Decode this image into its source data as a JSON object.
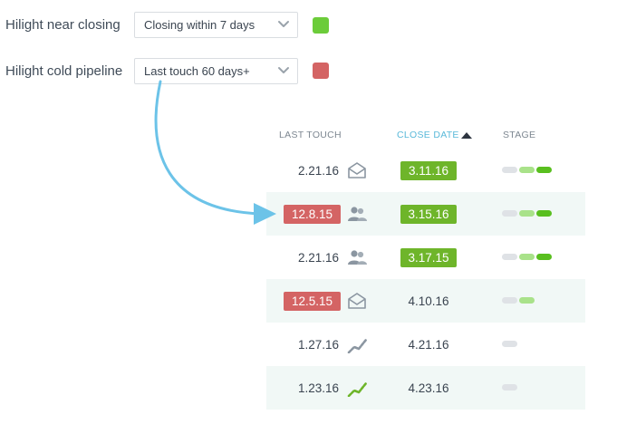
{
  "controls": {
    "near_closing": {
      "label": "Hilight near closing",
      "value": "Closing within 7 days",
      "swatch_color": "#6ccc3a"
    },
    "cold_pipeline": {
      "label": "Hilight cold pipeline",
      "value": "Last touch 60 days+",
      "swatch_color": "#d46464"
    }
  },
  "table": {
    "headers": {
      "last_touch": "LAST TOUCH",
      "close_date": "CLOSE DATE",
      "stage": "STAGE"
    },
    "rows": [
      {
        "last_touch": "2.21.16",
        "last_touch_highlight": false,
        "icon": "email-icon",
        "close_date": "3.11.16",
        "close_date_highlight": true,
        "stage": [
          "#dfe2e6",
          "#a9e28a",
          "#59bf1f"
        ]
      },
      {
        "last_touch": "12.8.15",
        "last_touch_highlight": true,
        "icon": "people-icon",
        "close_date": "3.15.16",
        "close_date_highlight": true,
        "stage": [
          "#dfe2e6",
          "#a9e28a",
          "#59bf1f"
        ]
      },
      {
        "last_touch": "2.21.16",
        "last_touch_highlight": false,
        "icon": "people-icon",
        "close_date": "3.17.15",
        "close_date_highlight": true,
        "stage": [
          "#dfe2e6",
          "#a9e28a",
          "#59bf1f"
        ]
      },
      {
        "last_touch": "12.5.15",
        "last_touch_highlight": true,
        "icon": "email-icon",
        "close_date": "4.10.16",
        "close_date_highlight": false,
        "stage": [
          "#dfe2e6",
          "#a9e28a"
        ]
      },
      {
        "last_touch": "1.27.16",
        "last_touch_highlight": false,
        "icon": "web-activity-icon",
        "close_date": "4.21.16",
        "close_date_highlight": false,
        "stage": [
          "#dfe2e6"
        ]
      },
      {
        "last_touch": "1.23.16",
        "last_touch_highlight": false,
        "icon": "web-activity-active-icon",
        "close_date": "4.23.16",
        "close_date_highlight": false,
        "stage": [
          "#dfe2e6"
        ]
      }
    ]
  },
  "colors": {
    "accent": "#5ab9d9",
    "arrow": "#6cc3e8",
    "row_alt": "#f1f8f6"
  }
}
